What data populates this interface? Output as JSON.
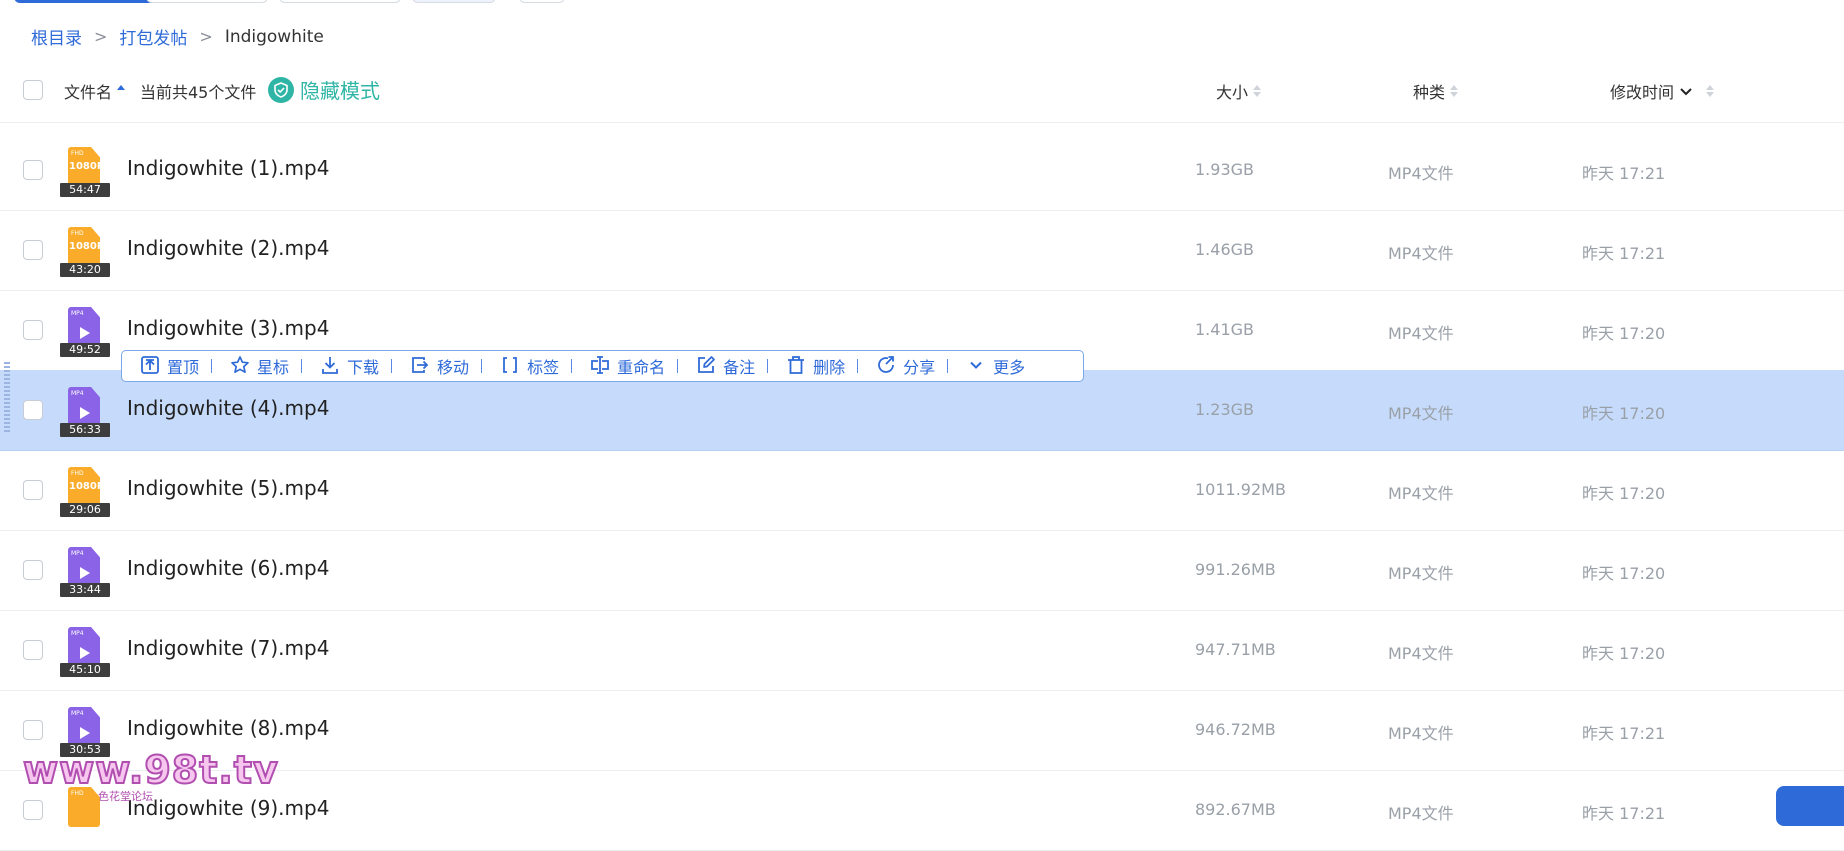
{
  "breadcrumb": {
    "items": [
      "根目录",
      "打包发帖"
    ],
    "current": "Indigowhite"
  },
  "header": {
    "col_name": "文件名",
    "count_text": "当前共45个文件",
    "hidden_mode": "隐藏模式",
    "col_size": "大小",
    "col_type": "种类",
    "col_mtime": "修改时间"
  },
  "files": [
    {
      "name": "Indigowhite (1).mp4",
      "size": "1.93GB",
      "type": "MP4文件",
      "mtime": "昨天 17:21",
      "icon": "orange-1080p-video-icon",
      "res": "1080P",
      "duration": "54:47"
    },
    {
      "name": "Indigowhite (2).mp4",
      "size": "1.46GB",
      "type": "MP4文件",
      "mtime": "昨天 17:21",
      "icon": "orange-1080p-video-icon",
      "res": "1080P",
      "duration": "43:20"
    },
    {
      "name": "Indigowhite (3).mp4",
      "size": "1.41GB",
      "type": "MP4文件",
      "mtime": "昨天 17:20",
      "icon": "purple-mp4-video-icon",
      "res": "",
      "duration": "49:52"
    },
    {
      "name": "Indigowhite (4).mp4",
      "size": "1.23GB",
      "type": "MP4文件",
      "mtime": "昨天 17:20",
      "icon": "purple-mp4-video-icon",
      "res": "",
      "duration": "56:33"
    },
    {
      "name": "Indigowhite (5).mp4",
      "size": "1011.92MB",
      "type": "MP4文件",
      "mtime": "昨天 17:20",
      "icon": "orange-1080p-video-icon",
      "res": "1080P",
      "duration": "29:06"
    },
    {
      "name": "Indigowhite (6).mp4",
      "size": "991.26MB",
      "type": "MP4文件",
      "mtime": "昨天 17:20",
      "icon": "purple-mp4-video-icon",
      "res": "",
      "duration": "33:44"
    },
    {
      "name": "Indigowhite (7).mp4",
      "size": "947.71MB",
      "type": "MP4文件",
      "mtime": "昨天 17:20",
      "icon": "purple-mp4-video-icon",
      "res": "",
      "duration": "45:10"
    },
    {
      "name": "Indigowhite (8).mp4",
      "size": "946.72MB",
      "type": "MP4文件",
      "mtime": "昨天 17:21",
      "icon": "purple-mp4-video-icon",
      "res": "",
      "duration": "30:53"
    },
    {
      "name": "Indigowhite (9).mp4",
      "size": "892.67MB",
      "type": "MP4文件",
      "mtime": "昨天 17:21",
      "icon": "orange-1080p-video-icon",
      "res": "",
      "duration": ""
    }
  ],
  "selected_index": 3,
  "toolbar": {
    "pin": "置顶",
    "star": "星标",
    "download": "下载",
    "move": "移动",
    "tag": "标签",
    "rename": "重命名",
    "note": "备注",
    "delete": "删除",
    "share": "分享",
    "more": "更多"
  },
  "watermark": {
    "text": "www.98t.tv",
    "sub": "色花堂论坛"
  },
  "colors": {
    "accent": "#2f6bd8",
    "selected_row": "#c6dbfb",
    "hidden_mode": "#2fb5a6",
    "orange_icon": "#f9ab29",
    "purple_icon": "#8a63e6"
  }
}
